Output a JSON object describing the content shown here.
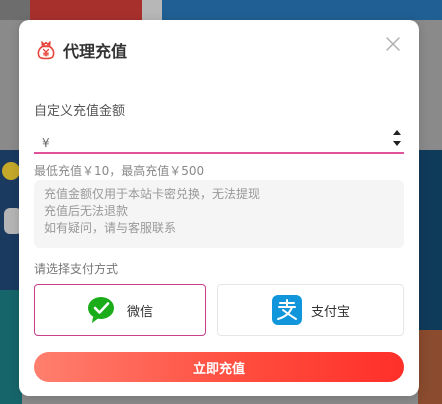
{
  "dialog": {
    "title": "代理充值",
    "title_icon": "money-bag-icon",
    "close_icon": "close-icon"
  },
  "amount": {
    "label": "自定义充值金额",
    "currency_symbol": "¥",
    "value": "",
    "placeholder": "",
    "range_hint": "最低充值￥10，最高充值￥500"
  },
  "notice": {
    "lines": [
      "充值金额仅用于本站卡密兑换，无法提现",
      "充值后无法退款",
      "如有疑问，请与客服联系"
    ]
  },
  "payment": {
    "label": "请选择支付方式",
    "options": [
      {
        "label": "微信",
        "icon": "wechat-icon",
        "selected": true
      },
      {
        "label": "支付宝",
        "icon": "alipay-icon",
        "selected": false
      }
    ]
  },
  "submit": {
    "label": "立即充值"
  },
  "colors": {
    "accent": "#e0529a",
    "button_start": "#ff7f6e",
    "button_end": "#ff2f2a",
    "wechat_green": "#1aad19",
    "alipay_blue": "#1296db"
  }
}
